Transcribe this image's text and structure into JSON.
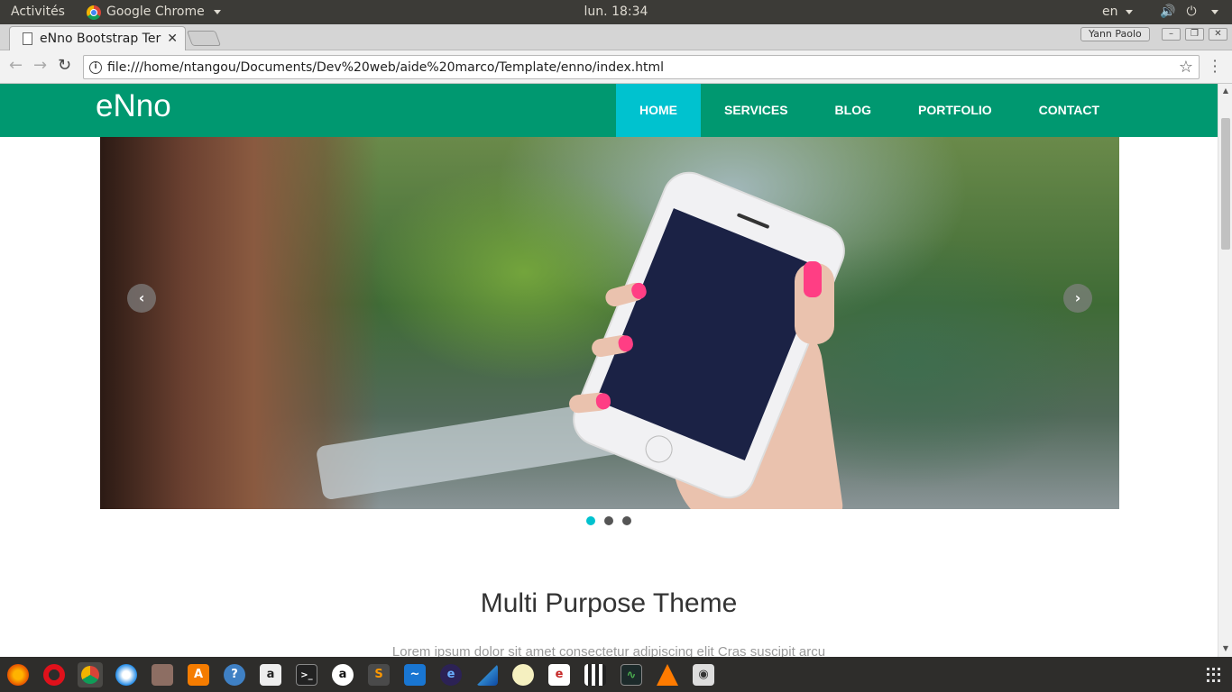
{
  "topbar": {
    "activities": "Activités",
    "app_name": "Google Chrome",
    "clock": "lun. 18:34",
    "language": "en"
  },
  "browser": {
    "tab_title": "eNno Bootstrap Ter",
    "profile_name": "Yann Paolo",
    "url": "file:///home/ntangou/Documents/Dev%20web/aide%20marco/Template/enno/index.html"
  },
  "site": {
    "brand": "eNno",
    "nav": [
      "HOME",
      "SERVICES",
      "BLOG",
      "PORTFOLIO",
      "CONTACT"
    ],
    "active_nav": "HOME",
    "colors": {
      "nav_bg": "#009870",
      "active_bg": "#00c2cf",
      "nail": "#ff3e84"
    },
    "carousel": {
      "slide_count": 3,
      "active_index": 0
    },
    "section_title": "Multi Purpose Theme",
    "section_text": "Lorem ipsum dolor sit amet consectetur adipiscing elit Cras suscipit arcu"
  },
  "taskbar": {
    "apps": [
      "firefox-icon",
      "opera-icon",
      "chrome-icon",
      "thunderbird-icon",
      "files-icon",
      "software-icon",
      "help-icon",
      "amazon-icon",
      "terminal-icon",
      "anki-icon",
      "sublime-icon",
      "monitor-icon",
      "eclipse-icon",
      "netbeans-icon",
      "webcam-icon",
      "ebook-icon",
      "video-editor-icon",
      "system-monitor-icon",
      "vlc-icon",
      "screenshot-icon"
    ]
  }
}
